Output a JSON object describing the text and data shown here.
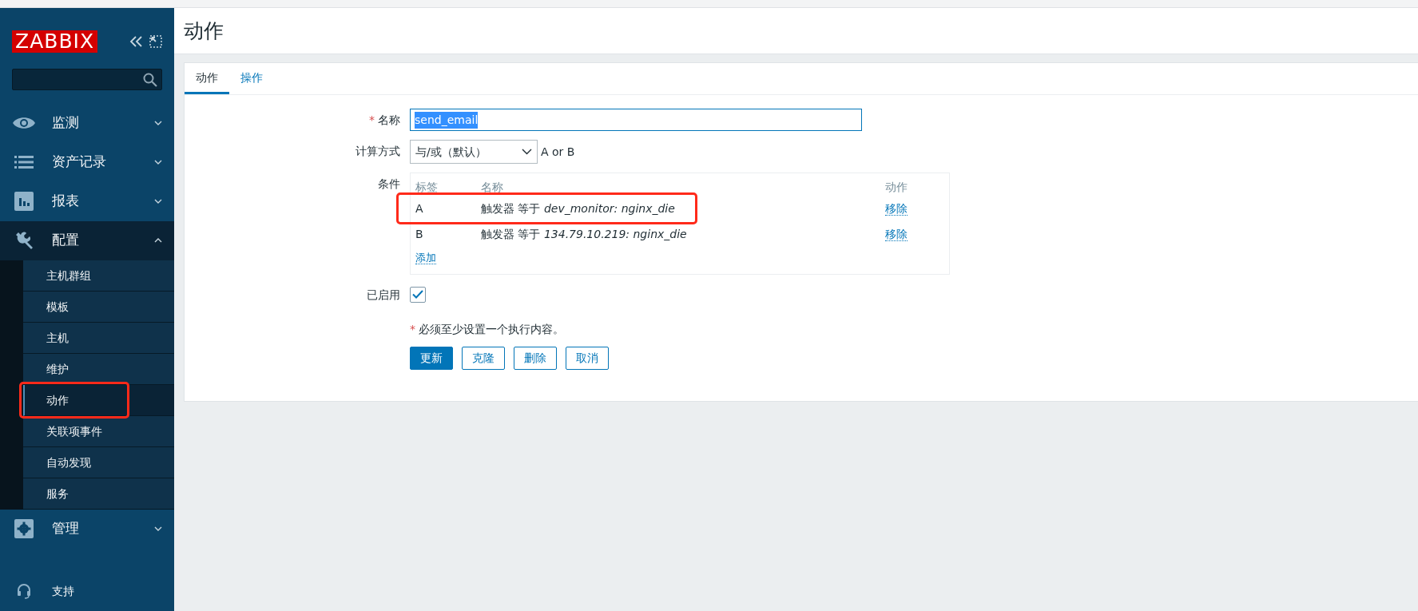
{
  "sidebar": {
    "logo": "ZABBIX",
    "menu": [
      {
        "label": "监测",
        "expanded": false
      },
      {
        "label": "资产记录",
        "expanded": false
      },
      {
        "label": "报表",
        "expanded": false
      },
      {
        "label": "配置",
        "expanded": true,
        "children": [
          {
            "label": "主机群组",
            "selected": false,
            "highlighted": false
          },
          {
            "label": "模板",
            "selected": false,
            "highlighted": false
          },
          {
            "label": "主机",
            "selected": false,
            "highlighted": false
          },
          {
            "label": "维护",
            "selected": false,
            "highlighted": false
          },
          {
            "label": "动作",
            "selected": true,
            "highlighted": true
          },
          {
            "label": "关联项事件",
            "selected": false,
            "highlighted": false
          },
          {
            "label": "自动发现",
            "selected": false,
            "highlighted": false
          },
          {
            "label": "服务",
            "selected": false,
            "highlighted": false
          }
        ]
      },
      {
        "label": "管理",
        "expanded": false
      }
    ],
    "footer": [
      {
        "label": "支持"
      }
    ]
  },
  "page_title": "动作",
  "tabs": [
    {
      "label": "动作",
      "selected": true
    },
    {
      "label": "操作",
      "selected": false
    }
  ],
  "form": {
    "name": {
      "required_mark": "*",
      "label": "名称",
      "value": "send_email",
      "text_selected": true
    },
    "calculation": {
      "label": "计算方式",
      "value": "与/或（默认）",
      "formula": "A or B"
    },
    "conditions": {
      "label": "条件",
      "columns": [
        "标签",
        "名称",
        "动作"
      ],
      "rows": [
        {
          "tag": "A",
          "condition": "触发器 等于 *dev_monitor: nginx_die*",
          "action": "移除",
          "highlighted": true
        },
        {
          "tag": "B",
          "condition": "触发器 等于 *134.79.10.219: nginx_die*",
          "action": "移除",
          "highlighted": false
        }
      ],
      "add": "添加"
    },
    "enabled": {
      "label": "已启用",
      "checked": true
    },
    "note": {
      "mark": "*",
      "text": "必须至少设置一个执行内容。"
    },
    "buttons": [
      {
        "label": "更新",
        "primary": true
      },
      {
        "label": "克隆",
        "primary": false
      },
      {
        "label": "删除",
        "primary": false
      },
      {
        "label": "取消",
        "primary": false
      }
    ]
  }
}
